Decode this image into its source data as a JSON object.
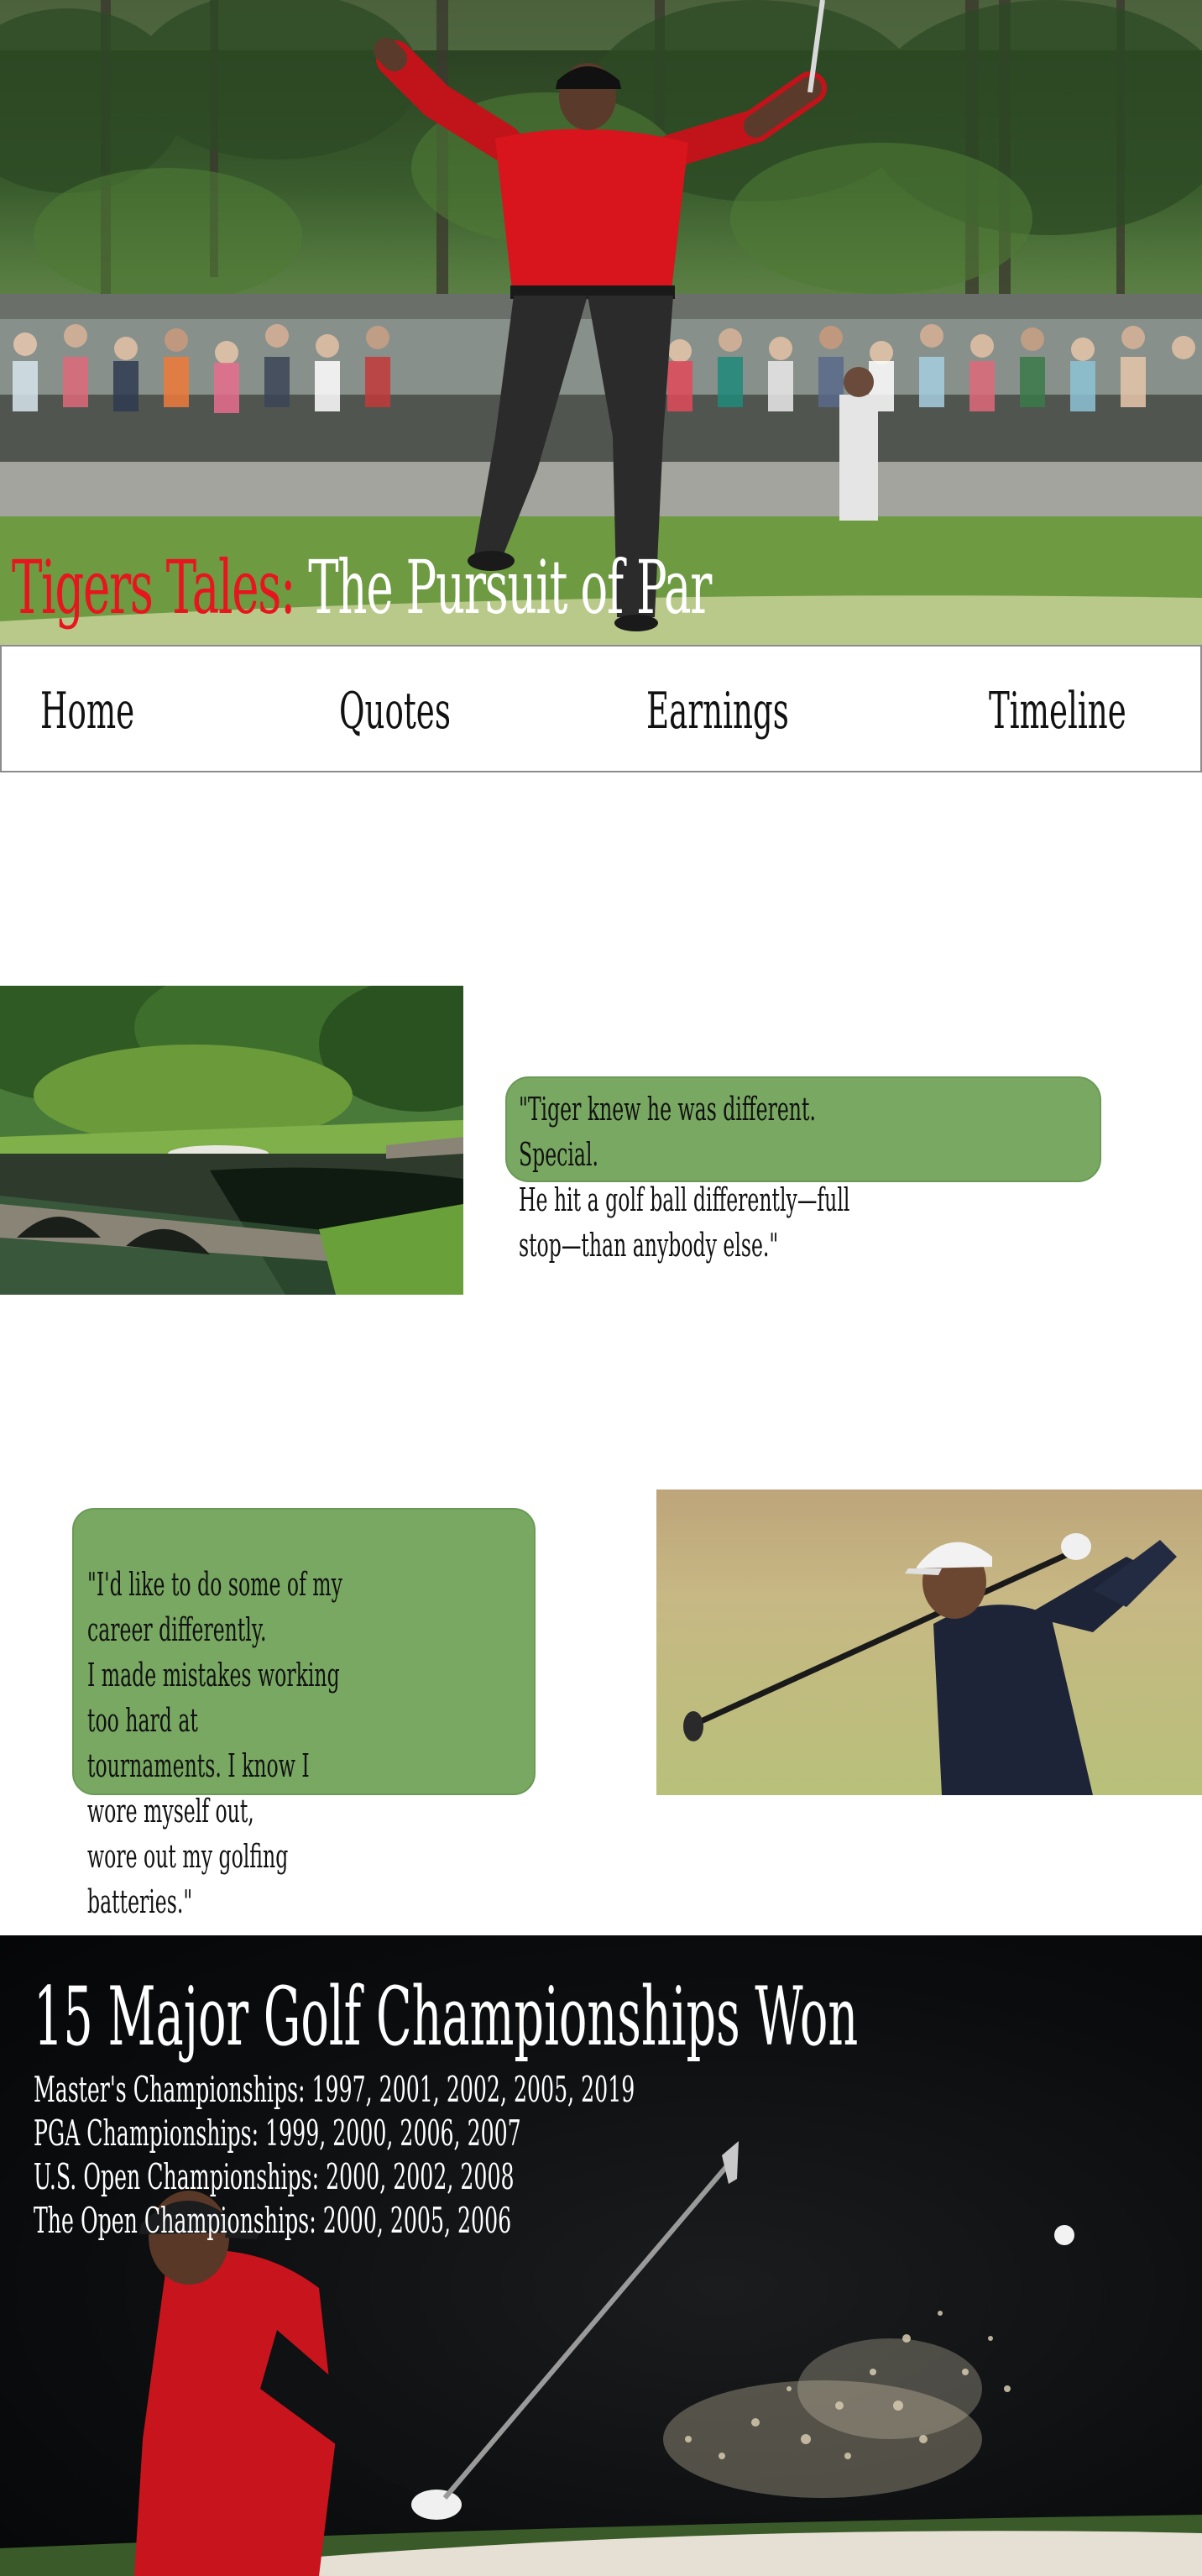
{
  "hero": {
    "title_accent": "Tigers Tales:",
    "title_rest": " The Pursuit of Par",
    "image": "golfer-celebrating-in-red-shirt-photo"
  },
  "nav": {
    "items": [
      {
        "label": "Home"
      },
      {
        "label": "Quotes"
      },
      {
        "label": "Earnings"
      },
      {
        "label": "Timeline"
      }
    ]
  },
  "quotes": [
    {
      "text": "\"Tiger knew he was different. Special.\n He hit a golf ball differently—full stop—than anybody else.\"",
      "image": "golf-course-bridge-photo"
    },
    {
      "text": "\"I'd like to do some of my career differently.\nI made mistakes working too hard at\ntournaments. I know I wore myself out,\nwore out my golfing batteries.\"",
      "image": "golfer-swinging-photo"
    }
  ],
  "championships": {
    "title": "15 Major Golf Championships Won",
    "lines": [
      "Master's Championships: 1997, 2001, 2002, 2005, 2019",
      "PGA Championships: 1999, 2000, 2006, 2007",
      "U.S. Open Championships: 2000, 2002, 2008",
      "The Open Championships: 2000, 2005, 2006"
    ],
    "image": "bunker-shot-sand-splash-photo"
  },
  "colors": {
    "accent_red": "#e8141e",
    "quote_green": "#78a862",
    "dark_section": "#0b0d0f"
  }
}
